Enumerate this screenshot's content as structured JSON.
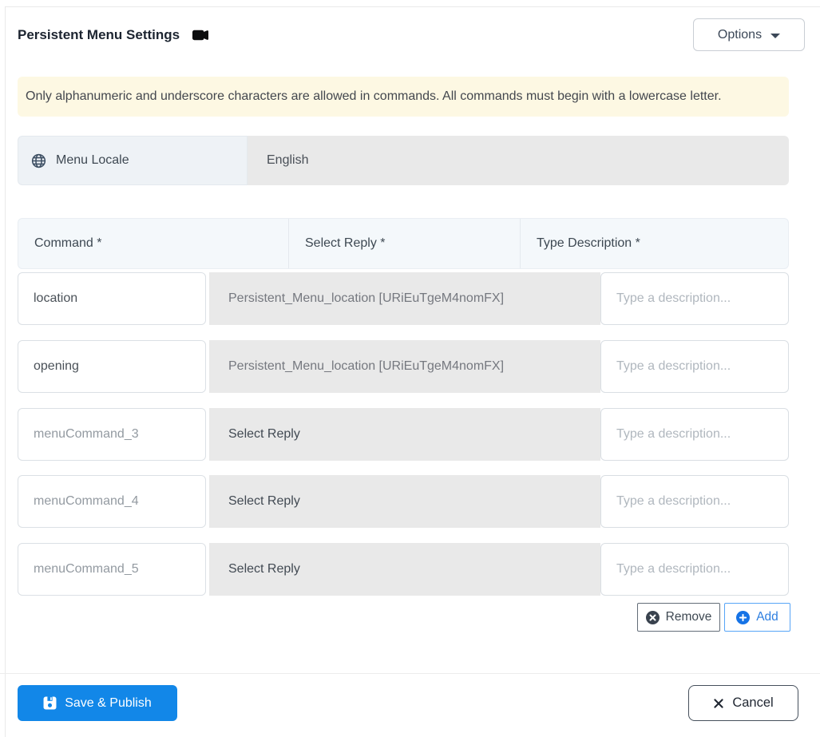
{
  "header": {
    "title": "Persistent Menu Settings",
    "options_label": "Options"
  },
  "alert": {
    "text": "Only alphanumeric and underscore characters are allowed in commands. All commands must begin with a lowercase letter."
  },
  "locale": {
    "label": "Menu Locale",
    "value": "English"
  },
  "table": {
    "headers": [
      "Command *",
      "Select Reply *",
      "Type Description *"
    ],
    "description_placeholder": "Type a description...",
    "rows": [
      {
        "command_value": "location",
        "reply": "Persistent_Menu_location [URiEuTgeM4nomFX]"
      },
      {
        "command_value": "opening",
        "reply": "Persistent_Menu_location [URiEuTgeM4nomFX]"
      },
      {
        "command_placeholder": "menuCommand_3",
        "reply": "Select Reply"
      },
      {
        "command_placeholder": "menuCommand_4",
        "reply": "Select Reply"
      },
      {
        "command_placeholder": "menuCommand_5",
        "reply": "Select Reply"
      }
    ]
  },
  "actions": {
    "remove_label": "Remove",
    "add_label": "Add"
  },
  "footer": {
    "save_label": "Save & Publish",
    "cancel_label": "Cancel"
  },
  "icons": {
    "video-camera-icon": "🎥",
    "globe-icon": "🌐",
    "chevron-down-icon": "▾",
    "remove-circle-icon": "⊗",
    "add-circle-icon": "⊕",
    "save-icon": "💾",
    "close-icon": "✕"
  },
  "colors": {
    "primary": "#1287e8",
    "add_accent": "#2e7fe0",
    "warning_bg": "#fdf8e3",
    "disabled_bg": "#e9e9e9",
    "header_row_bg": "#f4f8fb",
    "locale_label_bg": "#eef2f6"
  }
}
